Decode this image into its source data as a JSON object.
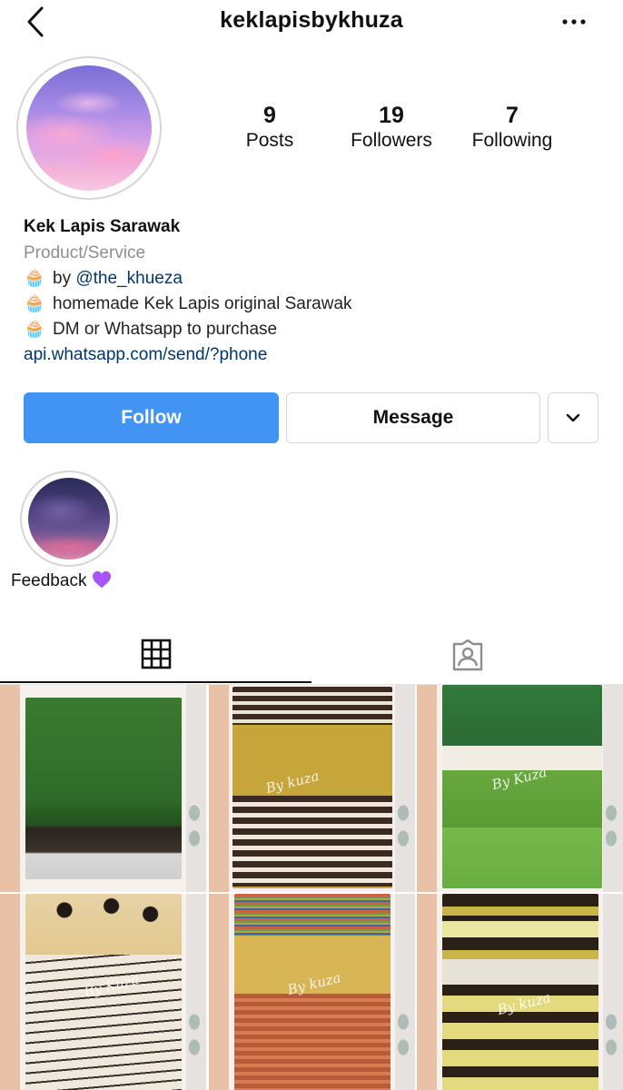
{
  "header": {
    "username": "keklapisbykhuza",
    "back_icon": "chevron-left-icon",
    "more_icon": "more-horizontal-icon"
  },
  "profile": {
    "stats": [
      {
        "value": "9",
        "label": "Posts"
      },
      {
        "value": "19",
        "label": "Followers"
      },
      {
        "value": "7",
        "label": "Following"
      }
    ],
    "name": "Kek Lapis Sarawak",
    "category": "Product/Service",
    "bio": {
      "line1_prefix": "by ",
      "line1_mention": "@the_khueza",
      "line2": "homemade Kek Lapis original Sarawak",
      "line3": "DM or Whatsapp to purchase"
    },
    "bio_emoji": "🧁",
    "website": "api.whatsapp.com/send/?phone"
  },
  "actions": {
    "follow_label": "Follow",
    "message_label": "Message",
    "more_icon": "chevron-down-icon"
  },
  "highlights": [
    {
      "label": "Feedback"
    }
  ],
  "tabs": [
    {
      "icon": "grid-icon",
      "active": true
    },
    {
      "icon": "tagged-icon",
      "active": false
    }
  ],
  "posts": [
    {
      "watermark": ""
    },
    {
      "watermark": "By kuza"
    },
    {
      "watermark": "By Kuza"
    },
    {
      "watermark": "By Kuza"
    },
    {
      "watermark": "By kuza"
    },
    {
      "watermark": "By kuza"
    }
  ],
  "colors": {
    "follow_button": "#4194f4",
    "link": "#00376b",
    "muted_text": "#8e8e8e",
    "heart": "#a855f7"
  }
}
